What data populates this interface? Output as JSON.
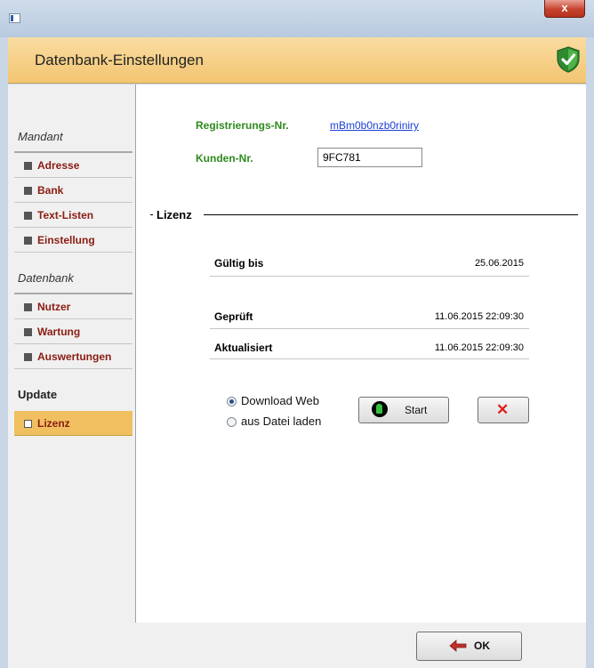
{
  "window": {
    "close_label": "x"
  },
  "header": {
    "title": "Datenbank-Einstellungen"
  },
  "sidebar": {
    "section_mandant": "Mandant",
    "section_datenbank": "Datenbank",
    "section_update": "Update",
    "mandant_items": [
      "Adresse",
      "Bank",
      "Text-Listen",
      "Einstellung"
    ],
    "datenbank_items": [
      "Nutzer",
      "Wartung",
      "Auswertungen"
    ],
    "update_items": [
      "Lizenz"
    ],
    "active_item": "Lizenz"
  },
  "registration": {
    "reg_label": "Registrierungs-Nr.",
    "reg_value": "mBm0b0nzb0riniry",
    "kunden_label": "Kunden-Nr.",
    "kunden_value": "9FC781"
  },
  "lizenz": {
    "title": "Lizenz",
    "gueltig_label": "Gültig bis",
    "gueltig_value": "25.06.2015",
    "geprueft_label": "Geprüft",
    "geprueft_value": "11.06.2015 22:09:30",
    "aktualisiert_label": "Aktualisiert",
    "aktualisiert_value": "11.06.2015 22:09:30"
  },
  "update_source": {
    "option_web": "Download Web",
    "option_file": "aus Datei laden",
    "selected": "Download Web"
  },
  "buttons": {
    "start_label": "Start",
    "ok_label": "OK"
  },
  "colors": {
    "header_bg": "#f3c572",
    "active_nav": "#f0c060",
    "label_green": "#2e8a1e",
    "nav_text": "#8a1c12",
    "link": "#1a3fd6"
  }
}
